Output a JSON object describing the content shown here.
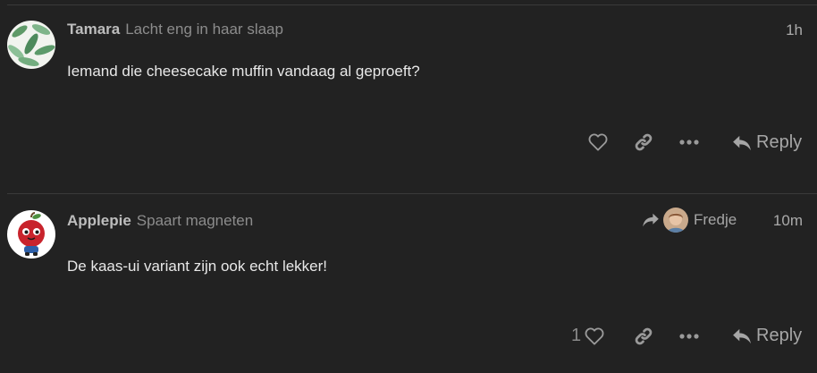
{
  "posts": [
    {
      "username": "Tamara",
      "user_title": "Lacht eng in haar slaap",
      "age": "1h",
      "body": "Iemand die cheesecake muffin vandaag al geproeft?",
      "avatar_icon": "leaf-pattern-avatar",
      "actions": {
        "reply_label": "Reply"
      }
    },
    {
      "username": "Applepie",
      "user_title": "Spaart magneten",
      "age": "10m",
      "reply_to": "Fredje",
      "body": "De kaas-ui variant zijn ook echt lekker!",
      "avatar_icon": "apple-character-avatar",
      "actions": {
        "like_count": "1",
        "reply_label": "Reply"
      }
    }
  ],
  "colors": {
    "background": "#222222",
    "text": "#e8e8e8",
    "muted": "#8c8c8c",
    "icon": "#9a9a9a",
    "divider": "#3a3a3a"
  }
}
